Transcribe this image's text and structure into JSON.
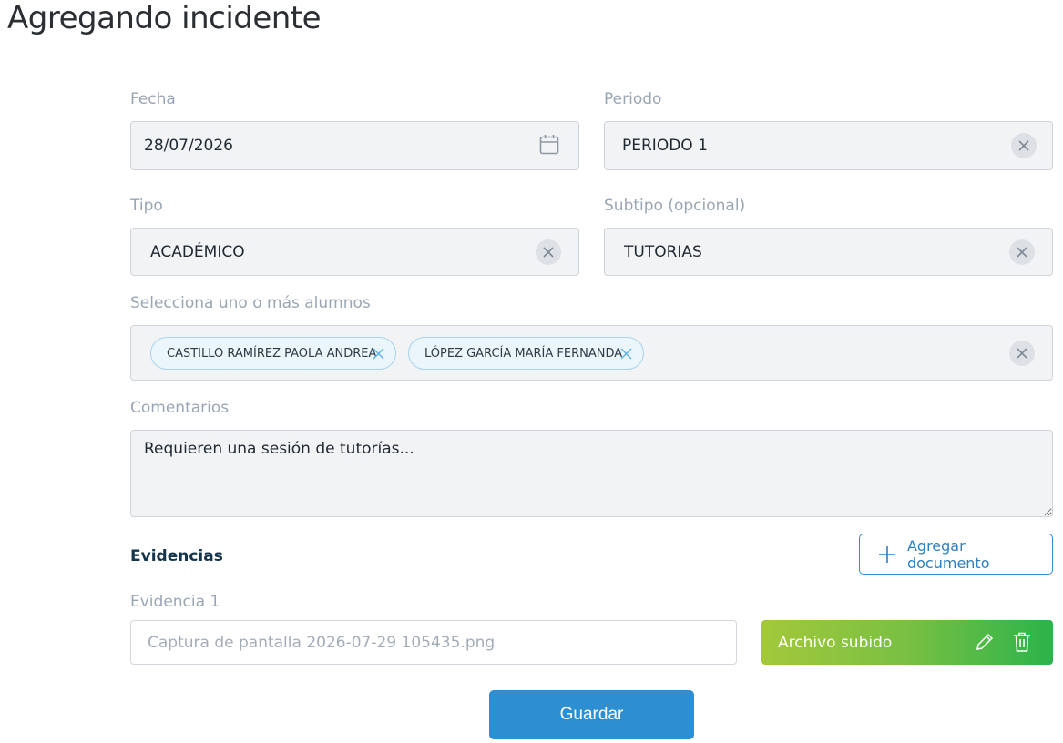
{
  "page": {
    "title": "Agregando incidente"
  },
  "fecha": {
    "label": "Fecha",
    "value": "28/07/2026",
    "icon": "calendar-icon"
  },
  "periodo": {
    "label": "Periodo",
    "value": "PERIODO 1"
  },
  "tipo": {
    "label": "Tipo",
    "value": "ACADÉMICO"
  },
  "subtipo": {
    "label": "Subtipo (opcional)",
    "value": "TUTORIAS"
  },
  "alumnos": {
    "label": "Selecciona uno o más alumnos",
    "selected": [
      "CASTILLO RAMÍREZ PAOLA ANDREA",
      "LÓPEZ GARCÍA MARÍA FERNANDA"
    ]
  },
  "comentarios": {
    "label": "Comentarios",
    "value": "Requieren una sesión de tutorías..."
  },
  "evidencias": {
    "title": "Evidencias",
    "add_button": "Agregar documento",
    "items": [
      {
        "label": "Evidencia 1",
        "file_name": "Captura de pantalla 2026-07-29 105435.png",
        "status": "Archivo subido"
      }
    ]
  },
  "actions": {
    "save_label": "Guardar"
  },
  "colors": {
    "primary": "#2d8fd2",
    "success_start": "#a3c83a",
    "success_end": "#2bb34a",
    "section_title": "#12344d"
  }
}
